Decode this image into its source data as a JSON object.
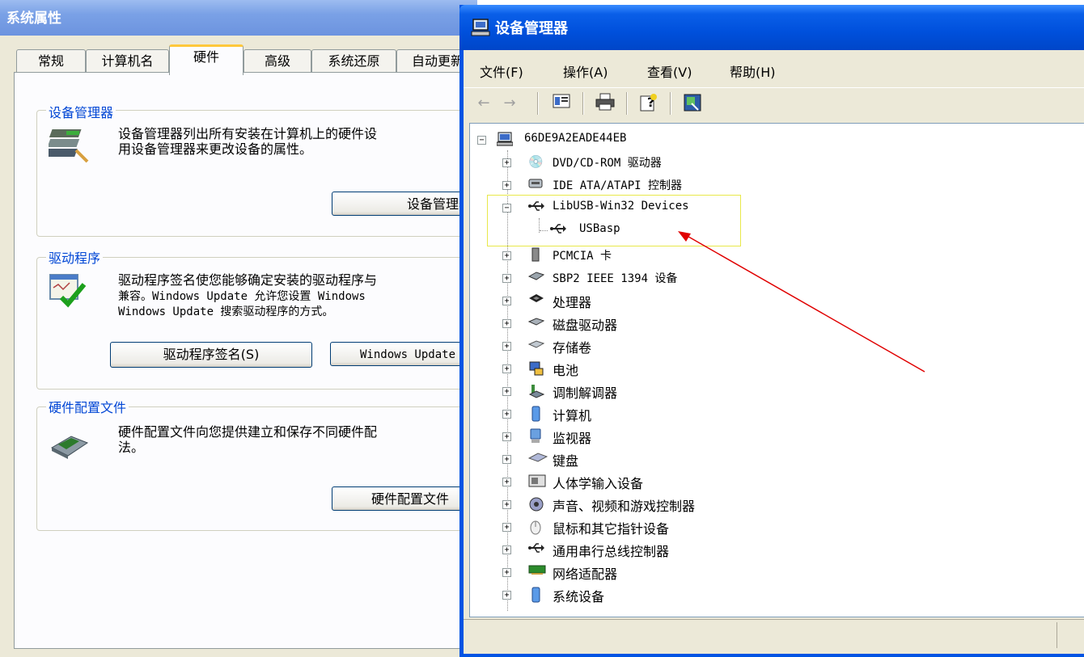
{
  "system_properties": {
    "title": "系统属性",
    "tabs": [
      "常规",
      "计算机名",
      "硬件",
      "高级",
      "系统还原",
      "自动更新"
    ],
    "active_tab": "硬件",
    "device_manager_group": {
      "title": "设备管理器",
      "description_line1": "设备管理器列出所有安装在计算机上的硬件设",
      "description_line2": "用设备管理器来更改设备的属性。",
      "button": "设备管理器"
    },
    "drivers_group": {
      "title": "驱动程序",
      "description_line1": "驱动程序签名使您能够确定安装的驱动程序与",
      "description_line2": "兼容。Windows Update 允许您设置 Windows",
      "description_line3": "Windows Update 搜索驱动程序的方式。",
      "button_signing": "驱动程序签名(S)",
      "button_update": "Windows Update"
    },
    "hardware_profiles_group": {
      "title": "硬件配置文件",
      "description_line1": "硬件配置文件向您提供建立和保存不同硬件配",
      "description_line2": "法。",
      "button": "硬件配置文件"
    }
  },
  "device_manager": {
    "title": "设备管理器",
    "menu": [
      "文件(F)",
      "操作(A)",
      "查看(V)",
      "帮助(H)"
    ],
    "toolbar_icons": [
      "back-arrow-icon",
      "forward-arrow-icon",
      "properties-pane-icon",
      "print-icon",
      "help-icon",
      "scan-hardware-icon"
    ],
    "tree": {
      "root": "66DE9A2EADE44EB",
      "items": [
        {
          "label": "DVD/CD-ROM 驱动器",
          "icon": "dvd-drive-icon",
          "expanded": false
        },
        {
          "label": "IDE ATA/ATAPI 控制器",
          "icon": "ide-controller-icon",
          "expanded": false
        },
        {
          "label": "LibUSB-Win32 Devices",
          "icon": "usb-icon",
          "expanded": true
        },
        {
          "label": "USBasp",
          "icon": "usb-icon",
          "child": true
        },
        {
          "label": "PCMCIA 卡",
          "icon": "pcmcia-icon",
          "expanded": false
        },
        {
          "label": "SBP2 IEEE 1394 设备",
          "icon": "ieee1394-icon",
          "expanded": false
        },
        {
          "label": "处理器",
          "icon": "processor-icon",
          "expanded": false
        },
        {
          "label": "磁盘驱动器",
          "icon": "disk-drive-icon",
          "expanded": false
        },
        {
          "label": "存储卷",
          "icon": "storage-volume-icon",
          "expanded": false
        },
        {
          "label": "电池",
          "icon": "battery-icon",
          "expanded": false
        },
        {
          "label": "调制解调器",
          "icon": "modem-icon",
          "expanded": false
        },
        {
          "label": "计算机",
          "icon": "computer-icon",
          "expanded": false
        },
        {
          "label": "监视器",
          "icon": "monitor-icon",
          "expanded": false
        },
        {
          "label": "键盘",
          "icon": "keyboard-icon",
          "expanded": false
        },
        {
          "label": "人体学输入设备",
          "icon": "hid-icon",
          "expanded": false
        },
        {
          "label": "声音、视频和游戏控制器",
          "icon": "sound-icon",
          "expanded": false
        },
        {
          "label": "鼠标和其它指针设备",
          "icon": "mouse-icon",
          "expanded": false
        },
        {
          "label": "通用串行总线控制器",
          "icon": "usb-icon",
          "expanded": false
        },
        {
          "label": "网络适配器",
          "icon": "network-adapter-icon",
          "expanded": false
        },
        {
          "label": "系统设备",
          "icon": "system-device-icon",
          "expanded": false
        }
      ]
    }
  },
  "colors": {
    "highlight_box": "#e8e84a",
    "annotation_arrow": "#e00000",
    "xp_title_blue": "#0054e3",
    "group_title": "#0046d5"
  }
}
